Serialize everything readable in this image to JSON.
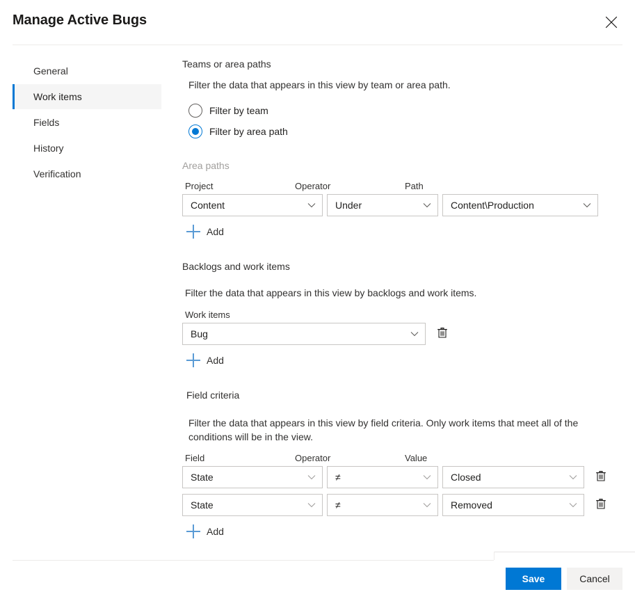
{
  "header": {
    "title": "Manage Active Bugs",
    "close_label": "Close"
  },
  "sidebar": {
    "items": [
      {
        "label": "General",
        "selected": false
      },
      {
        "label": "Work items",
        "selected": true
      },
      {
        "label": "Fields",
        "selected": false
      },
      {
        "label": "History",
        "selected": false
      },
      {
        "label": "Verification",
        "selected": false
      }
    ]
  },
  "teams_section": {
    "title": "Teams or area paths",
    "description": "Filter the data that appears in this view by team or area path.",
    "radios": [
      {
        "label": "Filter by team",
        "checked": false
      },
      {
        "label": "Filter by area path",
        "checked": true
      }
    ]
  },
  "area_paths": {
    "subtitle": "Area paths",
    "columns": {
      "project": "Project",
      "operator": "Operator",
      "path": "Path"
    },
    "rows": [
      {
        "project": "Content",
        "operator": "Under",
        "path": "Content\\Production"
      }
    ],
    "add_label": "Add"
  },
  "backlogs_section": {
    "title": "Backlogs and work items",
    "description": "Filter the data that appears in this view by backlogs and work items.",
    "field_label": "Work items",
    "rows": [
      {
        "value": "Bug"
      }
    ],
    "add_label": "Add",
    "delete_label": "Delete"
  },
  "field_criteria": {
    "title": "Field criteria",
    "description": "Filter the data that appears in this view by field criteria. Only work items that meet all of the conditions will be in the view.",
    "columns": {
      "field": "Field",
      "operator": "Operator",
      "value": "Value"
    },
    "rows": [
      {
        "field": "State",
        "operator": "≠",
        "value": "Closed"
      },
      {
        "field": "State",
        "operator": "≠",
        "value": "Removed"
      }
    ],
    "add_label": "Add",
    "delete_label": "Delete"
  },
  "footer": {
    "save_label": "Save",
    "cancel_label": "Cancel"
  },
  "colors": {
    "accent": "#0078d4",
    "add_plus": "#5a9bd5",
    "selected_nav_bg": "#f5f5f5",
    "border": "#c8c6c4",
    "muted_text": "#a19f9d"
  }
}
